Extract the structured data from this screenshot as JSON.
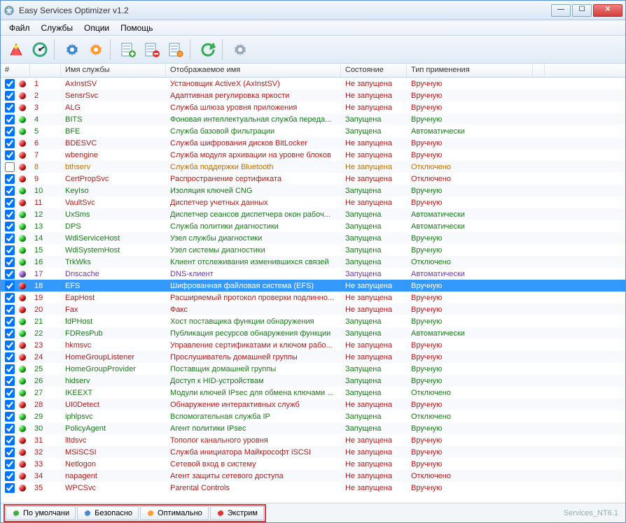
{
  "window": {
    "title": "Easy Services Optimizer v1.2"
  },
  "menubar": [
    "Файл",
    "Службы",
    "Опции",
    "Помощь"
  ],
  "columns": {
    "num": "#",
    "name": "Имя службы",
    "display": "Отображаемое имя",
    "state": "Состояние",
    "startup": "Тип применения"
  },
  "bottom_tabs": [
    "По умолчани",
    "Безопасно",
    "Оптимально",
    "Экстрим"
  ],
  "status_right": "Services_NT6.1",
  "selected_index": 17,
  "rows": [
    {
      "n": "1",
      "chk": true,
      "dot": "red",
      "name": "AxInstSV",
      "disp": "Установщик ActiveX (AxInstSV)",
      "state": "Не запущена",
      "startup": "Вручную",
      "c": "red"
    },
    {
      "n": "2",
      "chk": true,
      "dot": "red",
      "name": "SensrSvc",
      "disp": "Адаптивная регулировка яркости",
      "state": "Не запущена",
      "startup": "Вручную",
      "c": "red"
    },
    {
      "n": "3",
      "chk": true,
      "dot": "red",
      "name": "ALG",
      "disp": "Служба шлюза уровня приложения",
      "state": "Не запущена",
      "startup": "Вручную",
      "c": "red"
    },
    {
      "n": "4",
      "chk": true,
      "dot": "green",
      "name": "BITS",
      "disp": "Фоновая интеллектуальная служба переда...",
      "state": "Запущена",
      "startup": "Вручную",
      "c": "green"
    },
    {
      "n": "5",
      "chk": true,
      "dot": "green",
      "name": "BFE",
      "disp": "Служба базовой фильтрации",
      "state": "Запущена",
      "startup": "Автоматически",
      "c": "green"
    },
    {
      "n": "6",
      "chk": true,
      "dot": "red",
      "name": "BDESVC",
      "disp": "Служба шифрования дисков BitLocker",
      "state": "Не запущена",
      "startup": "Вручную",
      "c": "red"
    },
    {
      "n": "7",
      "chk": true,
      "dot": "red",
      "name": "wbengine",
      "disp": "Служба модуля архивации на уровне блоков",
      "state": "Не запущена",
      "startup": "Вручную",
      "c": "red"
    },
    {
      "n": "8",
      "chk": false,
      "dot": "red",
      "name": "bthserv",
      "disp": "Служба поддержки Bluetooth",
      "state": "Не запущена",
      "startup": "Отключено",
      "c": "orange"
    },
    {
      "n": "9",
      "chk": true,
      "dot": "red",
      "name": "CertPropSvc",
      "disp": "Распространение сертификата",
      "state": "Не запущена",
      "startup": "Отключено",
      "c": "red"
    },
    {
      "n": "10",
      "chk": true,
      "dot": "green",
      "name": "KeyIso",
      "disp": "Изоляция ключей CNG",
      "state": "Запущена",
      "startup": "Вручную",
      "c": "green"
    },
    {
      "n": "11",
      "chk": true,
      "dot": "red",
      "name": "VaultSvc",
      "disp": "Диспетчер учетных данных",
      "state": "Не запущена",
      "startup": "Вручную",
      "c": "red"
    },
    {
      "n": "12",
      "chk": true,
      "dot": "green",
      "name": "UxSms",
      "disp": "Диспетчер сеансов диспетчера окон рабоч...",
      "state": "Запущена",
      "startup": "Автоматически",
      "c": "green"
    },
    {
      "n": "13",
      "chk": true,
      "dot": "green",
      "name": "DPS",
      "disp": "Служба политики диагностики",
      "state": "Запущена",
      "startup": "Автоматически",
      "c": "green"
    },
    {
      "n": "14",
      "chk": true,
      "dot": "green",
      "name": "WdiServiceHost",
      "disp": "Узел службы диагностики",
      "state": "Запущена",
      "startup": "Вручную",
      "c": "green"
    },
    {
      "n": "15",
      "chk": true,
      "dot": "green",
      "name": "WdiSystemHost",
      "disp": "Узел системы диагностики",
      "state": "Запущена",
      "startup": "Вручную",
      "c": "green"
    },
    {
      "n": "16",
      "chk": true,
      "dot": "green",
      "name": "TrkWks",
      "disp": "Клиент отслеживания изменившихся связей",
      "state": "Запущена",
      "startup": "Отключено",
      "c": "green"
    },
    {
      "n": "17",
      "chk": true,
      "dot": "purple",
      "name": "Dnscache",
      "disp": "DNS-клиент",
      "state": "Запущена",
      "startup": "Автоматически",
      "c": "purple"
    },
    {
      "n": "18",
      "chk": true,
      "dot": "red",
      "name": "EFS",
      "disp": "Шифрованная файловая система (EFS)",
      "state": "Не запущена",
      "startup": "Вручную",
      "c": "red"
    },
    {
      "n": "19",
      "chk": true,
      "dot": "red",
      "name": "EapHost",
      "disp": "Расширяемый протокол проверки подлинно...",
      "state": "Не запущена",
      "startup": "Вручную",
      "c": "red"
    },
    {
      "n": "20",
      "chk": true,
      "dot": "red",
      "name": "Fax",
      "disp": "Факс",
      "state": "Не запущена",
      "startup": "Вручную",
      "c": "red"
    },
    {
      "n": "21",
      "chk": true,
      "dot": "green",
      "name": "fdPHost",
      "disp": "Хост поставщика функции обнаружения",
      "state": "Запущена",
      "startup": "Вручную",
      "c": "green"
    },
    {
      "n": "22",
      "chk": true,
      "dot": "green",
      "name": "FDResPub",
      "disp": "Публикация ресурсов обнаружения функции",
      "state": "Запущена",
      "startup": "Автоматически",
      "c": "green"
    },
    {
      "n": "23",
      "chk": true,
      "dot": "red",
      "name": "hkmsvc",
      "disp": "Управление сертификатами и ключом рабо...",
      "state": "Не запущена",
      "startup": "Вручную",
      "c": "red"
    },
    {
      "n": "24",
      "chk": true,
      "dot": "red",
      "name": "HomeGroupListener",
      "disp": "Прослушиватель домашней группы",
      "state": "Не запущена",
      "startup": "Вручную",
      "c": "red"
    },
    {
      "n": "25",
      "chk": true,
      "dot": "green",
      "name": "HomeGroupProvider",
      "disp": "Поставщик домашней группы",
      "state": "Запущена",
      "startup": "Вручную",
      "c": "green"
    },
    {
      "n": "26",
      "chk": true,
      "dot": "green",
      "name": "hidserv",
      "disp": "Доступ к HID-устройствам",
      "state": "Запущена",
      "startup": "Вручную",
      "c": "green"
    },
    {
      "n": "27",
      "chk": true,
      "dot": "green",
      "name": "IKEEXT",
      "disp": "Модули ключей IPsec для обмена ключами ...",
      "state": "Запущена",
      "startup": "Отключено",
      "c": "green"
    },
    {
      "n": "28",
      "chk": true,
      "dot": "red",
      "name": "UI0Detect",
      "disp": "Обнаружение интерактивных служб",
      "state": "Не запущена",
      "startup": "Вручную",
      "c": "red"
    },
    {
      "n": "29",
      "chk": true,
      "dot": "green",
      "name": "iphlpsvc",
      "disp": "Вспомогательная служба IP",
      "state": "Запущена",
      "startup": "Отключено",
      "c": "green"
    },
    {
      "n": "30",
      "chk": true,
      "dot": "green",
      "name": "PolicyAgent",
      "disp": "Агент политики IPsec",
      "state": "Запущена",
      "startup": "Вручную",
      "c": "green"
    },
    {
      "n": "31",
      "chk": true,
      "dot": "red",
      "name": "lltdsvc",
      "disp": "Тополог канального уровня",
      "state": "Не запущена",
      "startup": "Вручную",
      "c": "red"
    },
    {
      "n": "32",
      "chk": true,
      "dot": "red",
      "name": "MSiSCSI",
      "disp": "Служба инициатора Майкрософт iSCSI",
      "state": "Не запущена",
      "startup": "Вручную",
      "c": "red"
    },
    {
      "n": "33",
      "chk": true,
      "dot": "red",
      "name": "Netlogon",
      "disp": "Сетевой вход в систему",
      "state": "Не запущена",
      "startup": "Вручную",
      "c": "red"
    },
    {
      "n": "34",
      "chk": true,
      "dot": "red",
      "name": "napagent",
      "disp": "Агент защиты сетевого доступа",
      "state": "Не запущена",
      "startup": "Отключено",
      "c": "red"
    },
    {
      "n": "35",
      "chk": true,
      "dot": "red",
      "name": "WPCSvc",
      "disp": "Parental Controls",
      "state": "Не запущена",
      "startup": "Вручную",
      "c": "red"
    }
  ]
}
